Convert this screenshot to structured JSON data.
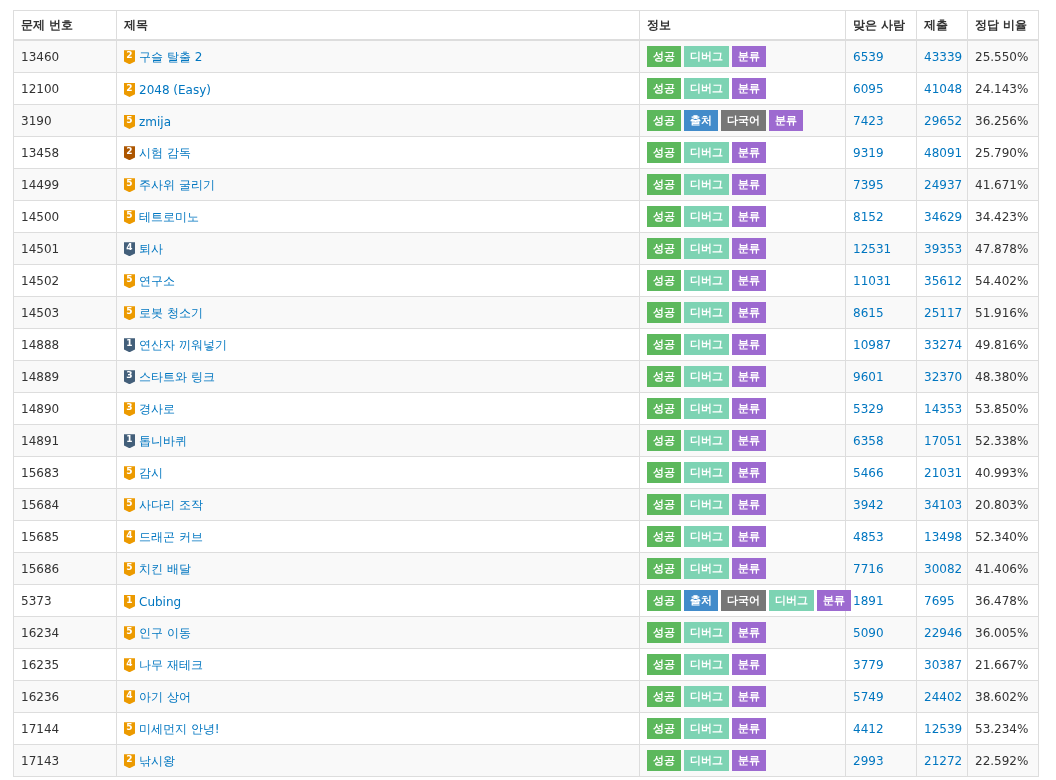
{
  "table": {
    "columns": [
      "문제 번호",
      "제목",
      "정보",
      "맞은 사람",
      "제출",
      "정답 비율"
    ],
    "rows": [
      {
        "id": "13460",
        "tier": {
          "label": "2",
          "color": "#ec9a00"
        },
        "title": "구슬 탈출 2",
        "labels": [
          {
            "text": "성공",
            "kind": "success"
          },
          {
            "text": "디버그",
            "kind": "debug"
          },
          {
            "text": "분류",
            "kind": "category"
          }
        ],
        "solved": "6539",
        "submissions": "43339",
        "ratio": "25.550%"
      },
      {
        "id": "12100",
        "tier": {
          "label": "2",
          "color": "#ec9a00"
        },
        "title": "2048 (Easy)",
        "labels": [
          {
            "text": "성공",
            "kind": "success"
          },
          {
            "text": "디버그",
            "kind": "debug"
          },
          {
            "text": "분류",
            "kind": "category"
          }
        ],
        "solved": "6095",
        "submissions": "41048",
        "ratio": "24.143%"
      },
      {
        "id": "3190",
        "tier": {
          "label": "5",
          "color": "#ec9a00"
        },
        "title": "zmija",
        "labels": [
          {
            "text": "성공",
            "kind": "success"
          },
          {
            "text": "출처",
            "kind": "source"
          },
          {
            "text": "다국어",
            "kind": "multilang"
          },
          {
            "text": "분류",
            "kind": "category"
          }
        ],
        "solved": "7423",
        "submissions": "29652",
        "ratio": "36.256%"
      },
      {
        "id": "13458",
        "tier": {
          "label": "2",
          "color": "#ad5600"
        },
        "title": "시험 감독",
        "labels": [
          {
            "text": "성공",
            "kind": "success"
          },
          {
            "text": "디버그",
            "kind": "debug"
          },
          {
            "text": "분류",
            "kind": "category"
          }
        ],
        "solved": "9319",
        "submissions": "48091",
        "ratio": "25.790%"
      },
      {
        "id": "14499",
        "tier": {
          "label": "5",
          "color": "#ec9a00"
        },
        "title": "주사위 굴리기",
        "labels": [
          {
            "text": "성공",
            "kind": "success"
          },
          {
            "text": "디버그",
            "kind": "debug"
          },
          {
            "text": "분류",
            "kind": "category"
          }
        ],
        "solved": "7395",
        "submissions": "24937",
        "ratio": "41.671%"
      },
      {
        "id": "14500",
        "tier": {
          "label": "5",
          "color": "#ec9a00"
        },
        "title": "테트로미노",
        "labels": [
          {
            "text": "성공",
            "kind": "success"
          },
          {
            "text": "디버그",
            "kind": "debug"
          },
          {
            "text": "분류",
            "kind": "category"
          }
        ],
        "solved": "8152",
        "submissions": "34629",
        "ratio": "34.423%"
      },
      {
        "id": "14501",
        "tier": {
          "label": "4",
          "color": "#435f7a"
        },
        "title": "퇴사",
        "labels": [
          {
            "text": "성공",
            "kind": "success"
          },
          {
            "text": "디버그",
            "kind": "debug"
          },
          {
            "text": "분류",
            "kind": "category"
          }
        ],
        "solved": "12531",
        "submissions": "39353",
        "ratio": "47.878%"
      },
      {
        "id": "14502",
        "tier": {
          "label": "5",
          "color": "#ec9a00"
        },
        "title": "연구소",
        "labels": [
          {
            "text": "성공",
            "kind": "success"
          },
          {
            "text": "디버그",
            "kind": "debug"
          },
          {
            "text": "분류",
            "kind": "category"
          }
        ],
        "solved": "11031",
        "submissions": "35612",
        "ratio": "54.402%"
      },
      {
        "id": "14503",
        "tier": {
          "label": "5",
          "color": "#ec9a00"
        },
        "title": "로봇 청소기",
        "labels": [
          {
            "text": "성공",
            "kind": "success"
          },
          {
            "text": "디버그",
            "kind": "debug"
          },
          {
            "text": "분류",
            "kind": "category"
          }
        ],
        "solved": "8615",
        "submissions": "25117",
        "ratio": "51.916%"
      },
      {
        "id": "14888",
        "tier": {
          "label": "1",
          "color": "#435f7a"
        },
        "title": "연산자 끼워넣기",
        "labels": [
          {
            "text": "성공",
            "kind": "success"
          },
          {
            "text": "디버그",
            "kind": "debug"
          },
          {
            "text": "분류",
            "kind": "category"
          }
        ],
        "solved": "10987",
        "submissions": "33274",
        "ratio": "49.816%"
      },
      {
        "id": "14889",
        "tier": {
          "label": "3",
          "color": "#435f7a"
        },
        "title": "스타트와 링크",
        "labels": [
          {
            "text": "성공",
            "kind": "success"
          },
          {
            "text": "디버그",
            "kind": "debug"
          },
          {
            "text": "분류",
            "kind": "category"
          }
        ],
        "solved": "9601",
        "submissions": "32370",
        "ratio": "48.380%"
      },
      {
        "id": "14890",
        "tier": {
          "label": "3",
          "color": "#ec9a00"
        },
        "title": "경사로",
        "labels": [
          {
            "text": "성공",
            "kind": "success"
          },
          {
            "text": "디버그",
            "kind": "debug"
          },
          {
            "text": "분류",
            "kind": "category"
          }
        ],
        "solved": "5329",
        "submissions": "14353",
        "ratio": "53.850%"
      },
      {
        "id": "14891",
        "tier": {
          "label": "1",
          "color": "#435f7a"
        },
        "title": "톱니바퀴",
        "labels": [
          {
            "text": "성공",
            "kind": "success"
          },
          {
            "text": "디버그",
            "kind": "debug"
          },
          {
            "text": "분류",
            "kind": "category"
          }
        ],
        "solved": "6358",
        "submissions": "17051",
        "ratio": "52.338%"
      },
      {
        "id": "15683",
        "tier": {
          "label": "5",
          "color": "#ec9a00"
        },
        "title": "감시",
        "labels": [
          {
            "text": "성공",
            "kind": "success"
          },
          {
            "text": "디버그",
            "kind": "debug"
          },
          {
            "text": "분류",
            "kind": "category"
          }
        ],
        "solved": "5466",
        "submissions": "21031",
        "ratio": "40.993%"
      },
      {
        "id": "15684",
        "tier": {
          "label": "5",
          "color": "#ec9a00"
        },
        "title": "사다리 조작",
        "labels": [
          {
            "text": "성공",
            "kind": "success"
          },
          {
            "text": "디버그",
            "kind": "debug"
          },
          {
            "text": "분류",
            "kind": "category"
          }
        ],
        "solved": "3942",
        "submissions": "34103",
        "ratio": "20.803%"
      },
      {
        "id": "15685",
        "tier": {
          "label": "4",
          "color": "#ec9a00"
        },
        "title": "드래곤 커브",
        "labels": [
          {
            "text": "성공",
            "kind": "success"
          },
          {
            "text": "디버그",
            "kind": "debug"
          },
          {
            "text": "분류",
            "kind": "category"
          }
        ],
        "solved": "4853",
        "submissions": "13498",
        "ratio": "52.340%"
      },
      {
        "id": "15686",
        "tier": {
          "label": "5",
          "color": "#ec9a00"
        },
        "title": "치킨 배달",
        "labels": [
          {
            "text": "성공",
            "kind": "success"
          },
          {
            "text": "디버그",
            "kind": "debug"
          },
          {
            "text": "분류",
            "kind": "category"
          }
        ],
        "solved": "7716",
        "submissions": "30082",
        "ratio": "41.406%"
      },
      {
        "id": "5373",
        "tier": {
          "label": "1",
          "color": "#ec9a00"
        },
        "title": "Cubing",
        "labels": [
          {
            "text": "성공",
            "kind": "success"
          },
          {
            "text": "출처",
            "kind": "source"
          },
          {
            "text": "다국어",
            "kind": "multilang"
          },
          {
            "text": "디버그",
            "kind": "debug"
          },
          {
            "text": "분류",
            "kind": "category"
          }
        ],
        "solved": "1891",
        "submissions": "7695",
        "ratio": "36.478%"
      },
      {
        "id": "16234",
        "tier": {
          "label": "5",
          "color": "#ec9a00"
        },
        "title": "인구 이동",
        "labels": [
          {
            "text": "성공",
            "kind": "success"
          },
          {
            "text": "디버그",
            "kind": "debug"
          },
          {
            "text": "분류",
            "kind": "category"
          }
        ],
        "solved": "5090",
        "submissions": "22946",
        "ratio": "36.005%"
      },
      {
        "id": "16235",
        "tier": {
          "label": "4",
          "color": "#ec9a00"
        },
        "title": "나무 재테크",
        "labels": [
          {
            "text": "성공",
            "kind": "success"
          },
          {
            "text": "디버그",
            "kind": "debug"
          },
          {
            "text": "분류",
            "kind": "category"
          }
        ],
        "solved": "3779",
        "submissions": "30387",
        "ratio": "21.667%"
      },
      {
        "id": "16236",
        "tier": {
          "label": "4",
          "color": "#ec9a00"
        },
        "title": "아기 상어",
        "labels": [
          {
            "text": "성공",
            "kind": "success"
          },
          {
            "text": "디버그",
            "kind": "debug"
          },
          {
            "text": "분류",
            "kind": "category"
          }
        ],
        "solved": "5749",
        "submissions": "24402",
        "ratio": "38.602%"
      },
      {
        "id": "17144",
        "tier": {
          "label": "5",
          "color": "#ec9a00"
        },
        "title": "미세먼지 안녕!",
        "labels": [
          {
            "text": "성공",
            "kind": "success"
          },
          {
            "text": "디버그",
            "kind": "debug"
          },
          {
            "text": "분류",
            "kind": "category"
          }
        ],
        "solved": "4412",
        "submissions": "12539",
        "ratio": "53.234%"
      },
      {
        "id": "17143",
        "tier": {
          "label": "2",
          "color": "#ec9a00"
        },
        "title": "낚시왕",
        "labels": [
          {
            "text": "성공",
            "kind": "success"
          },
          {
            "text": "디버그",
            "kind": "debug"
          },
          {
            "text": "분류",
            "kind": "category"
          }
        ],
        "solved": "2993",
        "submissions": "21272",
        "ratio": "22.592%"
      }
    ]
  }
}
